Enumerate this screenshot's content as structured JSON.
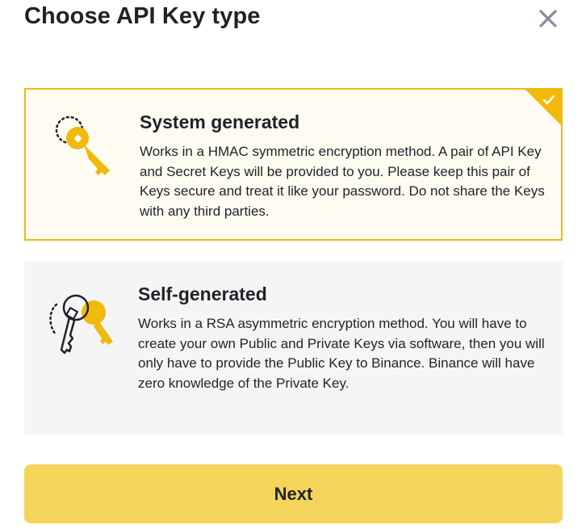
{
  "dialog": {
    "title": "Choose API Key type",
    "close_icon": "close-icon"
  },
  "options": [
    {
      "title": "System generated",
      "description": "Works in a HMAC symmetric encryption method. A pair of API Key and Secret Keys will be provided to you. Please keep this pair of Keys secure and treat it like your password. Do not share the Keys with any third parties.",
      "icon": "system-key-icon",
      "selected": true
    },
    {
      "title": "Self-generated",
      "description": "Works in a RSA asymmetric encryption method. You will have to create your own Public and Private Keys via software, then you will only have to provide the Public Key to Binance. Binance will have zero knowledge of the Private Key.",
      "icon": "keypair-icon",
      "selected": false
    }
  ],
  "next_button": {
    "label": "Next"
  },
  "colors": {
    "accent": "#f0b90b",
    "button": "#f5d45b",
    "selected_bg": "#fefbf0",
    "unselected_bg": "#f5f5f5",
    "text": "#1e2329"
  }
}
